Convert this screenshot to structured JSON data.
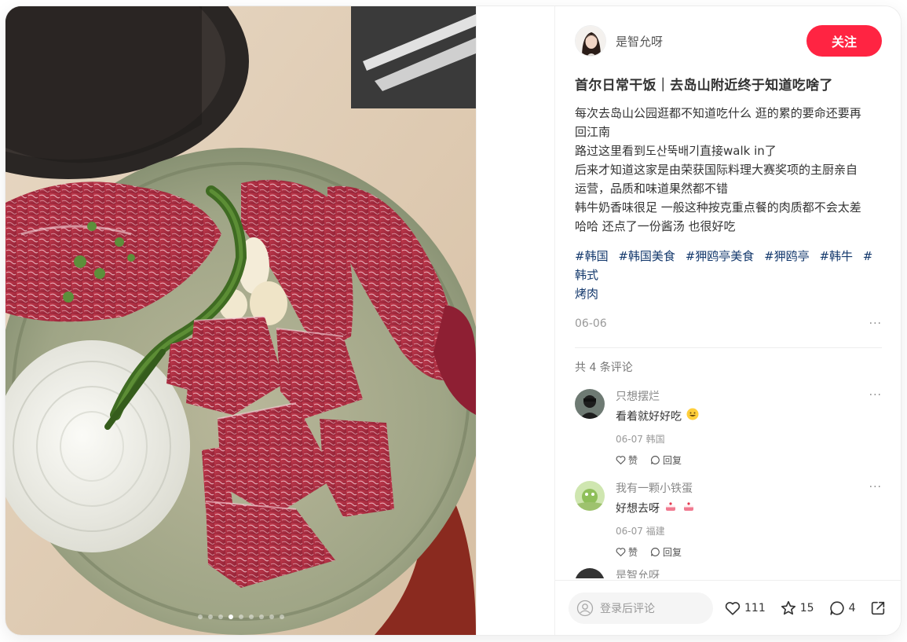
{
  "post": {
    "images_total": 9,
    "image_index": 4
  },
  "author": {
    "name": "是智允呀",
    "follow_label": "关注"
  },
  "note": {
    "title": "首尔日常干饭｜去岛山附近终于知道吃啥了",
    "description_lines": [
      "每次去岛山公园逛都不知道吃什么 逛的累的要命还要再",
      "回江南",
      "路过这里看到도산뚝배기直接walk in了",
      "后来才知道这家是由荣获国际料理大赛奖项的主厨亲自",
      "运营，品质和味道果然都不错",
      "韩牛奶香味很足 一般这种按克重点餐的肉质都不会太差",
      "哈哈 还点了一份酱汤 也很好吃"
    ],
    "tags": [
      "#韩国",
      "#韩国美食",
      "#狎鸥亭美食",
      "#狎鸥亭",
      "#韩牛",
      "#韩式",
      "烤肉"
    ],
    "date": "06-06",
    "more": "···"
  },
  "comments": {
    "count_label": "共 4 条评论",
    "items": [
      {
        "user": "只想摆烂",
        "text": "看着就好好吃",
        "emoji": "grin-emoji",
        "meta": "06-07 韩国",
        "like_label": "赞",
        "reply_label": "回复"
      },
      {
        "user": "我有一颗小铁蛋",
        "text": "好想去呀",
        "emoji": "cake-emoji",
        "meta": "06-07 福建",
        "like_label": "赞",
        "reply_label": "回复"
      }
    ],
    "peek_user": "是智允呀"
  },
  "bottom_bar": {
    "input_placeholder": "登录后评论",
    "likes": "111",
    "collects": "15",
    "comments": "4"
  },
  "colors": {
    "accent": "#ff2442",
    "tag": "#13386c"
  }
}
